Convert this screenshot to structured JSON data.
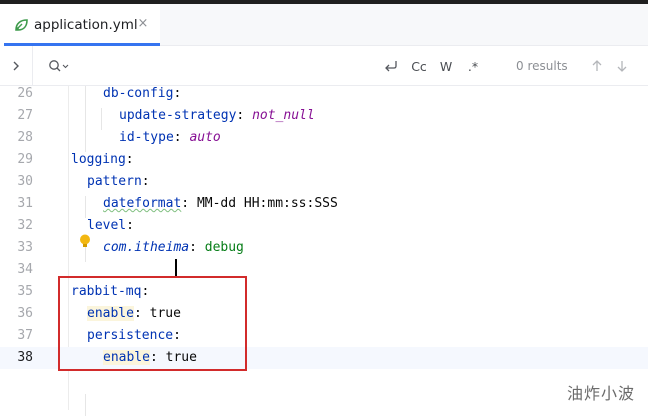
{
  "tab": {
    "filename": "application.yml",
    "close_glyph": "×",
    "icon": "spring-leaf-icon"
  },
  "find_bar": {
    "expand_glyph": "›",
    "search_icon": "search-icon",
    "match_case_label": "Cc",
    "words_label": "W",
    "regex_label": ".*",
    "results_text": "0 results"
  },
  "editor": {
    "current_line": 38,
    "lines": [
      {
        "n": "26",
        "tokens": [
          {
            "t": "db-config",
            "c": "k"
          },
          {
            "t": ":",
            "c": "p"
          }
        ]
      },
      {
        "n": "27",
        "tokens": [
          {
            "t": "update-strategy",
            "c": "k"
          },
          {
            "t": ": ",
            "c": "p"
          },
          {
            "t": "not_null",
            "c": "vi"
          }
        ]
      },
      {
        "n": "28",
        "tokens": [
          {
            "t": "id-type",
            "c": "k"
          },
          {
            "t": ": ",
            "c": "p"
          },
          {
            "t": "auto",
            "c": "vi"
          }
        ]
      },
      {
        "n": "29",
        "tokens": [
          {
            "t": "logging",
            "c": "k"
          },
          {
            "t": ":",
            "c": "p"
          }
        ]
      },
      {
        "n": "30",
        "tokens": [
          {
            "t": "pattern",
            "c": "k"
          },
          {
            "t": ":",
            "c": "p"
          }
        ]
      },
      {
        "n": "31",
        "tokens": [
          {
            "t": "dateformat",
            "c": "k sq"
          },
          {
            "t": ": ",
            "c": "p"
          },
          {
            "t": "MM-dd HH:mm:ss:SSS",
            "c": "v"
          }
        ]
      },
      {
        "n": "32",
        "tokens": [
          {
            "t": "level",
            "c": "k"
          },
          {
            "t": ":",
            "c": "p"
          }
        ]
      },
      {
        "n": "33",
        "tokens": [
          {
            "t": "com.itheima",
            "c": "nk"
          },
          {
            "t": ": ",
            "c": "p"
          },
          {
            "t": "debug",
            "c": "vb"
          }
        ]
      },
      {
        "n": "34",
        "tokens": []
      },
      {
        "n": "35",
        "tokens": [
          {
            "t": "rabbit-mq",
            "c": "k"
          },
          {
            "t": ":",
            "c": "p"
          }
        ]
      },
      {
        "n": "36",
        "tokens": [
          {
            "t": "enable",
            "c": "k hl"
          },
          {
            "t": ": ",
            "c": "p"
          },
          {
            "t": "true",
            "c": "v"
          }
        ]
      },
      {
        "n": "37",
        "tokens": [
          {
            "t": "persistence",
            "c": "k"
          },
          {
            "t": ":",
            "c": "p"
          }
        ]
      },
      {
        "n": "38",
        "tokens": [
          {
            "t": "enable",
            "c": "k hl"
          },
          {
            "t": ": ",
            "c": "p"
          },
          {
            "t": "true",
            "c": "v"
          }
        ]
      }
    ]
  },
  "watermark": "油炸小波",
  "colors": {
    "accent": "#3574f0",
    "highlight_box": "#d22b2b",
    "key": "#0033b3"
  }
}
